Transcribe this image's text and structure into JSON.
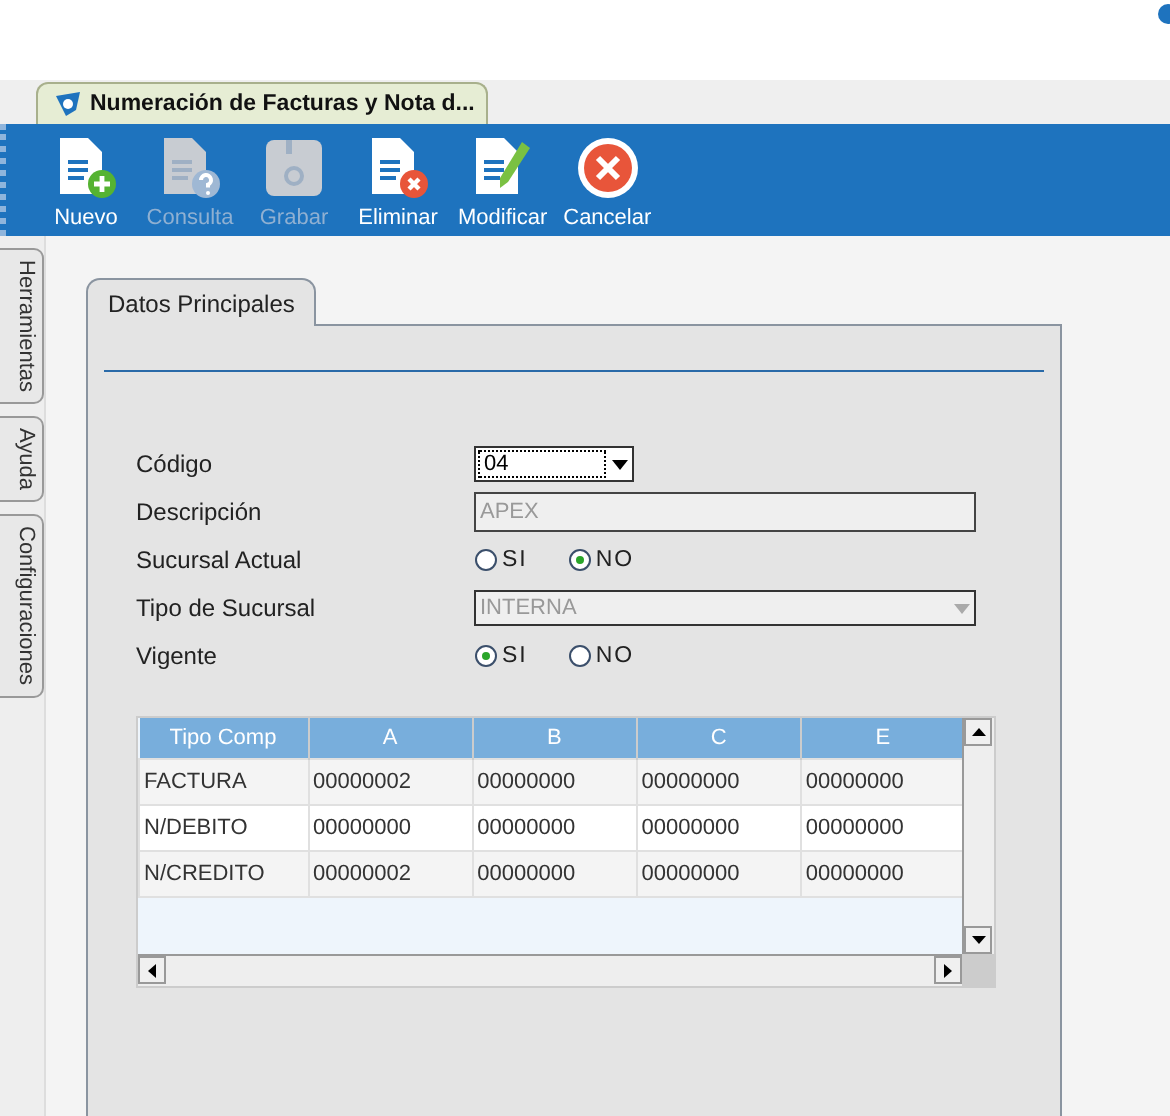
{
  "document_tab": {
    "title": "Numeración de Facturas y Nota d...",
    "selected": true
  },
  "toolbar": [
    {
      "label": "Nuevo",
      "kind": "new",
      "disabled": false
    },
    {
      "label": "Consulta",
      "kind": "query",
      "disabled": true
    },
    {
      "label": "Grabar",
      "kind": "save",
      "disabled": true
    },
    {
      "label": "Eliminar",
      "kind": "delete",
      "disabled": false
    },
    {
      "label": "Modificar",
      "kind": "edit",
      "disabled": false
    },
    {
      "label": "Cancelar",
      "kind": "cancel",
      "disabled": false
    }
  ],
  "side_tabs": [
    {
      "label": "Herramientas"
    },
    {
      "label": "Ayuda"
    },
    {
      "label": "Configuraciones"
    }
  ],
  "panel_tab": {
    "label": "Datos Principales",
    "selected": true
  },
  "form": [
    {
      "kind": "combo",
      "label": "Código",
      "value": "04",
      "disabled": false
    },
    {
      "kind": "text",
      "label": "Descripción",
      "value": "APEX",
      "disabled": true
    },
    {
      "kind": "radio",
      "label": "Sucursal Actual",
      "options": [
        {
          "label": "SI",
          "selected": false
        },
        {
          "label": "NO",
          "selected": true
        }
      ]
    },
    {
      "kind": "combo",
      "label": "Tipo de Sucursal",
      "value": "INTERNA",
      "disabled": true
    },
    {
      "kind": "radio",
      "label": "Vigente",
      "options": [
        {
          "label": "SI",
          "selected": true
        },
        {
          "label": "NO",
          "selected": false
        }
      ]
    }
  ],
  "table": {
    "columns": [
      "Tipo Comp",
      "A",
      "B",
      "C",
      "E"
    ],
    "rows": [
      [
        "FACTURA",
        "00000002",
        "00000000",
        "00000000",
        "00000000"
      ],
      [
        "N/DEBITO",
        "00000000",
        "00000000",
        "00000000",
        "00000000"
      ],
      [
        "N/CREDITO",
        "00000002",
        "00000000",
        "00000000",
        "00000000"
      ]
    ]
  }
}
